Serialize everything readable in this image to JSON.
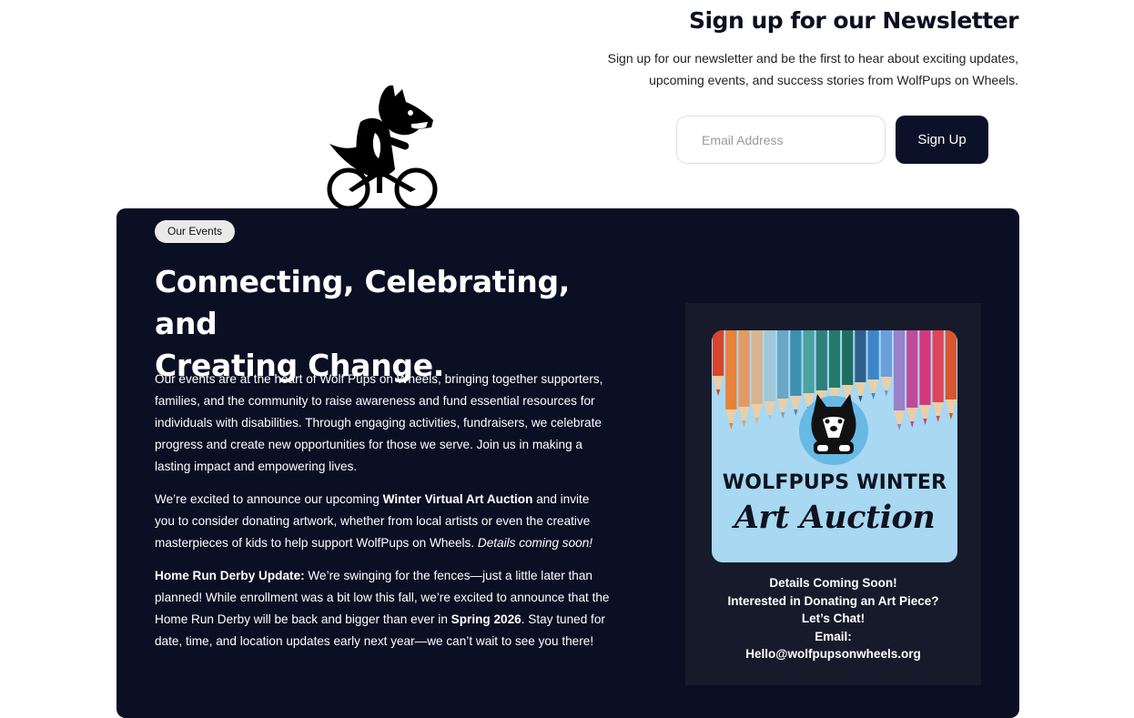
{
  "newsletter": {
    "title": "Sign up for our Newsletter",
    "description_line1": "Sign up for our newsletter and be the first to hear about exciting updates,",
    "description_line2": "upcoming events, and success stories from WolfPups on Wheels.",
    "email_placeholder": "Email Address",
    "button_label": "Sign Up"
  },
  "mascot": {
    "icon": "wolf-on-bicycle-icon"
  },
  "events": {
    "tag": "Our Events",
    "heading_line1": "Connecting, Celebrating, and",
    "heading_line2": "Creating Change.",
    "paragraph1": "Our events are at the heart of Wolf Pups on Wheels, bringing together supporters, families, and the community to raise awareness and fund essential resources for individuals with disabilities. Through engaging activities, fundraisers, we celebrate progress and create new opportunities for those we serve. Join us in making a lasting impact and empowering lives.",
    "paragraph2": {
      "intro": "We’re excited to announce our upcoming ",
      "highlight": "Winter Virtual Art Auction",
      "rest": " and invite you to consider donating artwork, whether from local artists or even the creative masterpieces of kids to help support WolfPups on Wheels. ",
      "italic": "Details coming soon!"
    },
    "paragraph3": {
      "label": "Home Run Derby Update:",
      "text1": " We’re swinging for the fences—just a little later than planned! While enrollment was a bit low this fall, we’re excited to announce that the Home Run Derby will be back and bigger than ever in ",
      "highlight": "Spring 2026",
      "text2": ". Stay tuned for date, time, and location updates early next year—we can’t wait to see you there!"
    }
  },
  "card": {
    "poster_title": "WOLFPUPS WINTER",
    "poster_subtitle": "Art Auction",
    "line1": "Details Coming Soon!",
    "line2": "Interested in Donating an Art Piece?",
    "line3": "Let’s Chat!",
    "line4": "Email:",
    "line5": "Hello@wolfpupsonwheels.org"
  },
  "colors": {
    "navy": "#0a0f24",
    "button": "#0b1128",
    "poster_bg": "#a8d8f2"
  }
}
